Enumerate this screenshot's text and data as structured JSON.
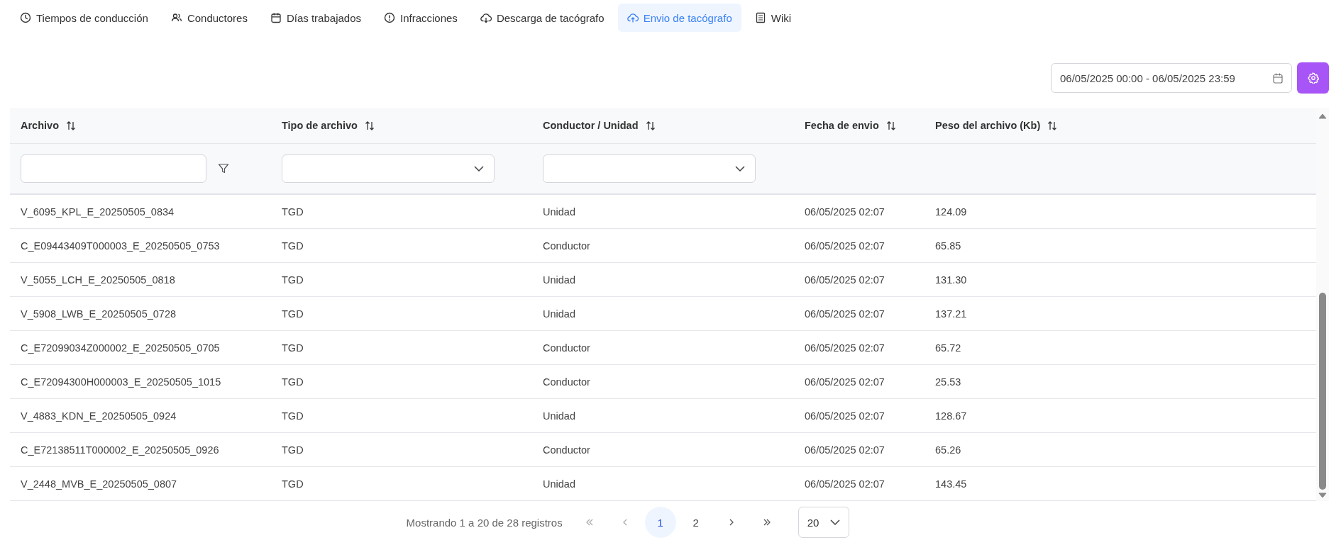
{
  "tabs": [
    {
      "label": "Tiempos de conducción",
      "selected": false
    },
    {
      "label": "Conductores",
      "selected": false
    },
    {
      "label": "Días trabajados",
      "selected": false
    },
    {
      "label": "Infracciones",
      "selected": false
    },
    {
      "label": "Descarga de tacógrafo",
      "selected": false
    },
    {
      "label": "Envio de tacógrafo",
      "selected": true
    },
    {
      "label": "Wiki",
      "selected": false
    }
  ],
  "date_range": {
    "value": "06/05/2025 00:00 - 06/05/2025 23:59"
  },
  "table": {
    "columns": [
      {
        "label": "Archivo",
        "kind": "text"
      },
      {
        "label": "Tipo de archivo",
        "kind": "select"
      },
      {
        "label": "Conductor / Unidad",
        "kind": "select"
      },
      {
        "label": "Fecha de envio",
        "kind": "plain"
      },
      {
        "label": "Peso del archivo (Kb)",
        "kind": "plain"
      }
    ],
    "rows": [
      [
        "V_6095_KPL_E_20250505_0834",
        "TGD",
        "Unidad",
        "06/05/2025 02:07",
        "124.09"
      ],
      [
        "C_E09443409T000003_E_20250505_0753",
        "TGD",
        "Conductor",
        "06/05/2025 02:07",
        "65.85"
      ],
      [
        "V_5055_LCH_E_20250505_0818",
        "TGD",
        "Unidad",
        "06/05/2025 02:07",
        "131.30"
      ],
      [
        "V_5908_LWB_E_20250505_0728",
        "TGD",
        "Unidad",
        "06/05/2025 02:07",
        "137.21"
      ],
      [
        "C_E72099034Z000002_E_20250505_0705",
        "TGD",
        "Conductor",
        "06/05/2025 02:07",
        "65.72"
      ],
      [
        "C_E72094300H000003_E_20250505_1015",
        "TGD",
        "Conductor",
        "06/05/2025 02:07",
        "25.53"
      ],
      [
        "V_4883_KDN_E_20250505_0924",
        "TGD",
        "Unidad",
        "06/05/2025 02:07",
        "128.67"
      ],
      [
        "C_E72138511T000002_E_20250505_0926",
        "TGD",
        "Conductor",
        "06/05/2025 02:07",
        "65.26"
      ],
      [
        "V_2448_MVB_E_20250505_0807",
        "TGD",
        "Unidad",
        "06/05/2025 02:07",
        "143.45"
      ]
    ]
  },
  "pagination": {
    "summary": "Mostrando 1 a 20 de 28 registros",
    "pages": [
      {
        "label": "1",
        "selected": true
      },
      {
        "label": "2",
        "selected": false
      }
    ],
    "page_size": "20"
  }
}
